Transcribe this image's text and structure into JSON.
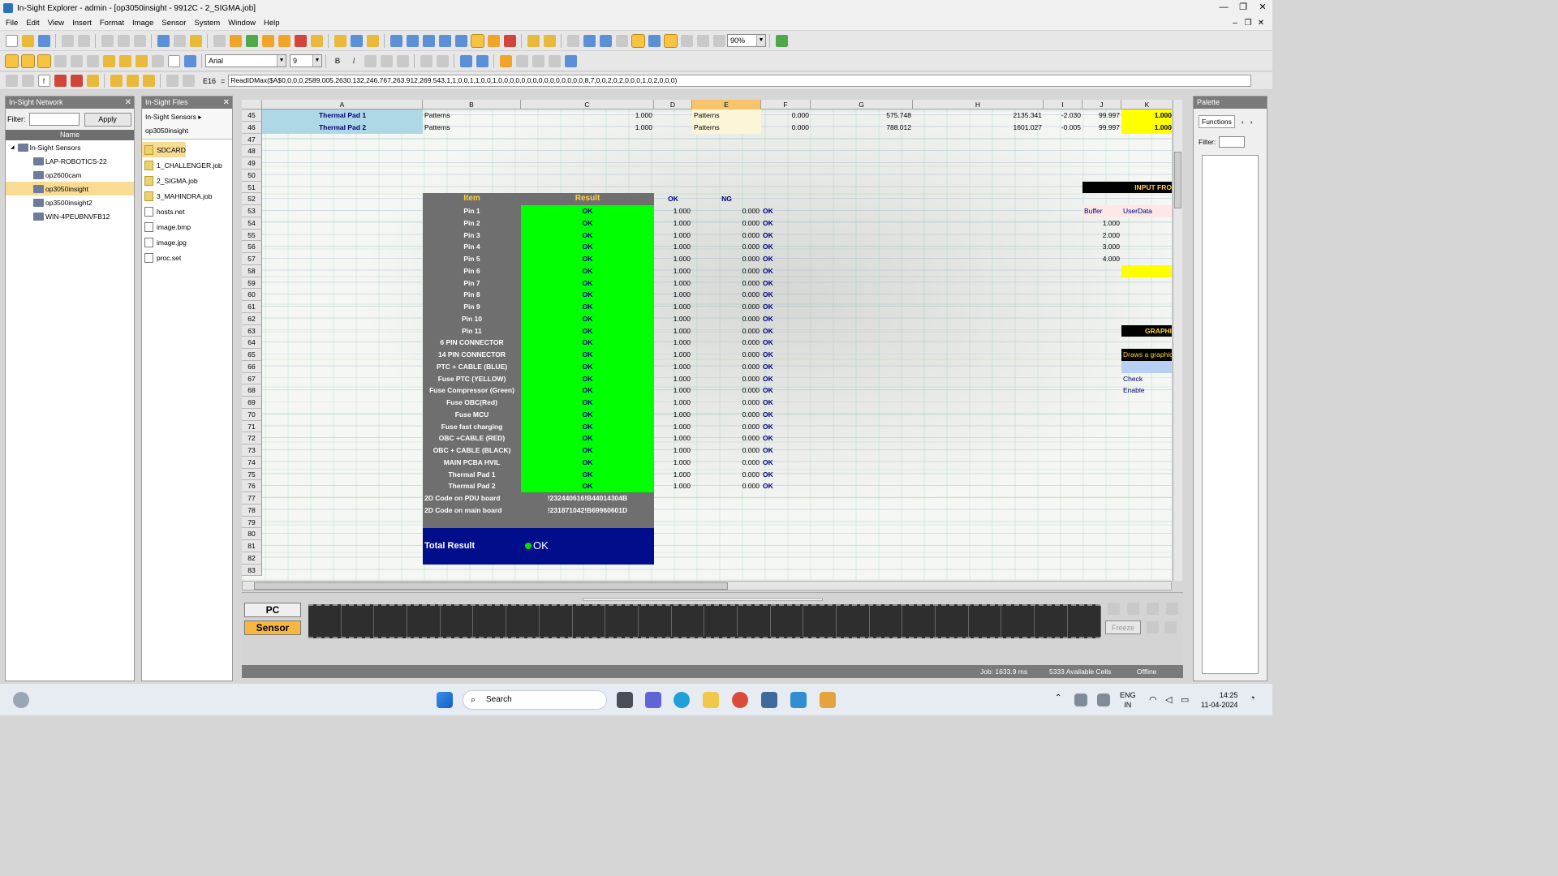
{
  "window": {
    "title": "In-Sight Explorer - admin - [op3050insight - 9912C - 2_SIGMA.job]",
    "min": "—",
    "restore": "❐",
    "close": "✕"
  },
  "menu": [
    "File",
    "Edit",
    "View",
    "Insert",
    "Format",
    "Image",
    "Sensor",
    "System",
    "Window",
    "Help"
  ],
  "toolbar": {
    "zoom": "90%",
    "font_name": "Arial",
    "font_size": "9",
    "bold": "B",
    "italic": "I"
  },
  "formula_bar": {
    "cell_ref": "E16",
    "equals": "=",
    "formula": "ReadIDMax($A$0,0,0,0,2589.005,2630.132,246.767,263.912,269.543,1,1,0,0,1,1,0,0,1,0,0,0,0,0,0,0,0,0,0,0,0,0,0,0,8,7,0,0,2,0,2,0,0,0,1,0,2,0,0,0)"
  },
  "network_panel": {
    "title": "In-Sight Network",
    "close": "✕",
    "filter_label": "Filter:",
    "filter_value": "",
    "apply_label": "Apply",
    "col_name": "Name",
    "tree": [
      {
        "label": "In-Sight Sensors",
        "level": 0,
        "selected": false
      },
      {
        "label": "LAP-ROBOTICS-22",
        "level": 1,
        "selected": false
      },
      {
        "label": "op2600cam",
        "level": 1,
        "selected": false
      },
      {
        "label": "op3050insight",
        "level": 1,
        "selected": true
      },
      {
        "label": "op3500insight2",
        "level": 1,
        "selected": false
      },
      {
        "label": "WIN-4PEUBNVFB12",
        "level": 1,
        "selected": false
      }
    ]
  },
  "files_panel": {
    "title": "In-Sight Files",
    "close": "✕",
    "path1": "In-Sight Sensors",
    "path2": "op3050insight",
    "files": [
      {
        "label": "SDCARD",
        "selected": true,
        "type": "folder"
      },
      {
        "label": "1_CHALLENGER.job",
        "selected": false,
        "type": "job"
      },
      {
        "label": "2_SIGMA.job",
        "selected": false,
        "type": "job"
      },
      {
        "label": "3_MAHINDRA.job",
        "selected": false,
        "type": "job"
      },
      {
        "label": "hosts.net",
        "selected": false,
        "type": "file"
      },
      {
        "label": "image.bmp",
        "selected": false,
        "type": "file"
      },
      {
        "label": "image.jpg",
        "selected": false,
        "type": "file"
      },
      {
        "label": "proc.set",
        "selected": false,
        "type": "set"
      }
    ]
  },
  "spreadsheet": {
    "columns": [
      "A",
      "B",
      "C",
      "D",
      "E",
      "F",
      "G",
      "H",
      "I",
      "J",
      "K"
    ],
    "selected_column": "E",
    "rows": [
      "45",
      "46",
      "47",
      "48",
      "49",
      "50",
      "51",
      "52",
      "53",
      "54",
      "55",
      "56",
      "57",
      "58",
      "59",
      "60",
      "61",
      "62",
      "63",
      "64",
      "65",
      "66",
      "67",
      "68",
      "69",
      "70",
      "71",
      "72",
      "73",
      "74",
      "75",
      "76",
      "77",
      "78",
      "79",
      "80",
      "81",
      "82",
      "83"
    ],
    "row45": {
      "a": "Thermal Pad 1",
      "b": "Patterns",
      "c": "1.000",
      "e": "Patterns",
      "f": "0.000",
      "g": "575.748",
      "h": "2135.341",
      "i": "-2.030",
      "j": "99.997",
      "k": "1.000"
    },
    "row46": {
      "a": "Thermal Pad 2",
      "b": "Patterns",
      "c": "1.000",
      "e": "Patterns",
      "f": "0.000",
      "g": "788.012",
      "h": "1601.027",
      "i": "-0.005",
      "j": "99.997",
      "k": "1.000"
    },
    "result_header": {
      "item": "Item",
      "result": "Result",
      "ok": "OK",
      "ng": "NG"
    },
    "items": [
      "Pin 1",
      "Pin 2",
      "Pin 3",
      "Pin 4",
      "Pin 5",
      "Pin 6",
      "Pin 7",
      "Pin 8",
      "Pin 9",
      "Pin 10",
      "Pin 11",
      "6 PIN CONNECTOR",
      "14 PIN CONNECTOR",
      "PTC + CABLE (BLUE)",
      "Fuse PTC (YELLOW)",
      "Fuse Compressor (Green)",
      "Fuse OBC(Red)",
      "Fuse MCU",
      "Fuse fast charging",
      "OBC +CABLE (RED)",
      "OBC + CABLE (BLACK)",
      "MAIN PCBA HVIL",
      "Thermal Pad 1",
      "Thermal Pad 2"
    ],
    "result_value": "OK",
    "ok_value": "1.000",
    "ng_value": "0.000",
    "f_value": "OK",
    "code_rows": [
      {
        "label": "2D Code on PDU board",
        "value": "!232440616!B44014304B"
      },
      {
        "label": "2D Code on main board",
        "value": "!231871042!B69960601D"
      }
    ],
    "total": {
      "label": "Total Result",
      "value": "OK"
    },
    "right": {
      "input_header": "INPUT FRO",
      "buffer": "Buffer",
      "userdata": "UserData",
      "buffer_values": [
        "1.000",
        "2.000",
        "3.000",
        "4.000"
      ],
      "graph_header": "GRAPHI",
      "graph_desc": "Draws a graphic",
      "check": "Check",
      "enable": "Enable"
    }
  },
  "film": {
    "pc_label": "PC",
    "sensor_label": "Sensor",
    "freeze_label": "Freeze"
  },
  "status": {
    "job": "Job: 1633.9 ms",
    "cells": "5333 Available Cells",
    "state": "Offline"
  },
  "palette": {
    "title": "Palette",
    "tab": "Functions",
    "filter_label": "Filter:"
  },
  "taskbar": {
    "search": "Search",
    "lang1": "ENG",
    "lang2": "IN",
    "time": "14:25",
    "date": "11-04-2024"
  },
  "colors": {
    "green": "#00ff00",
    "navy": "#000e8c",
    "yellow": "#ffff00",
    "gray": "#6f6f6f"
  }
}
